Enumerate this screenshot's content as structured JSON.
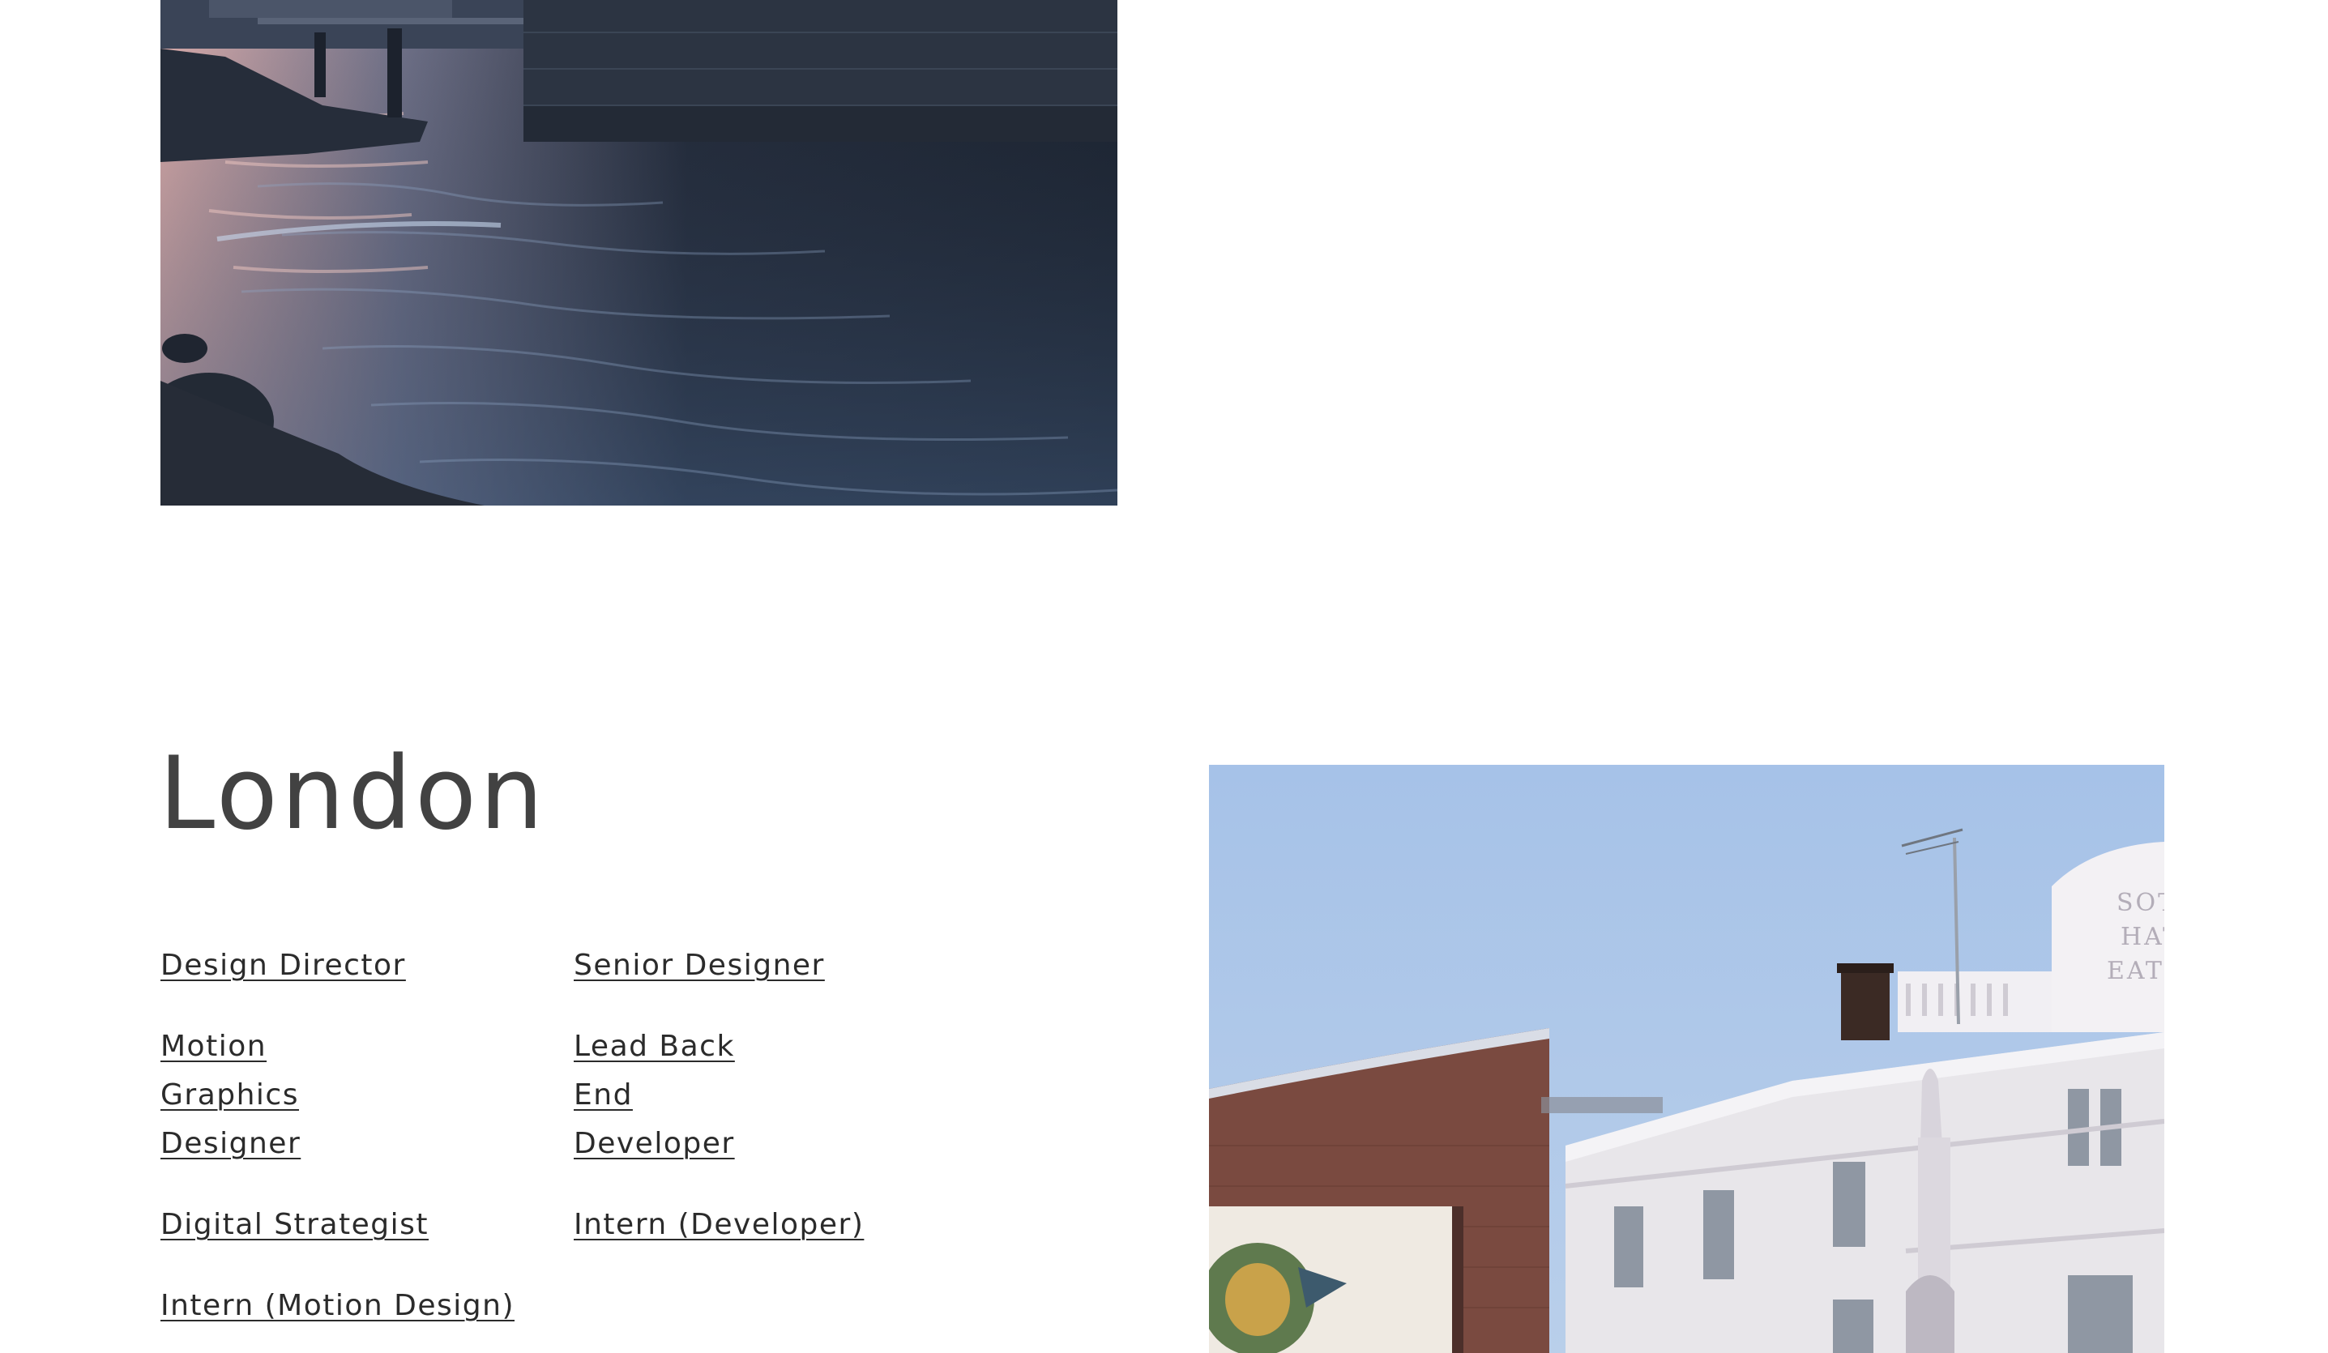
{
  "top_photo": {
    "alt": "River at dusk beneath a stone bridge"
  },
  "london": {
    "title": "London",
    "jobs_column_a": [
      "Design Director",
      "Motion Graphics Designer",
      "Digital Strategist",
      "Intern (Motion Design)"
    ],
    "jobs_column_b": [
      "Senior Designer",
      "Lead Back End Developer",
      "Intern (Developer)"
    ],
    "photo": {
      "alt": "London street with white theatre building and brick building with mural",
      "sign_lines": [
        "SOTH",
        "HAT",
        "EATR"
      ]
    }
  },
  "colors": {
    "background": "#ffffff",
    "title_text": "#424242",
    "link_text": "#2b2b2b",
    "sky": "#a9c4e6",
    "water_dark": "#1f2836"
  }
}
